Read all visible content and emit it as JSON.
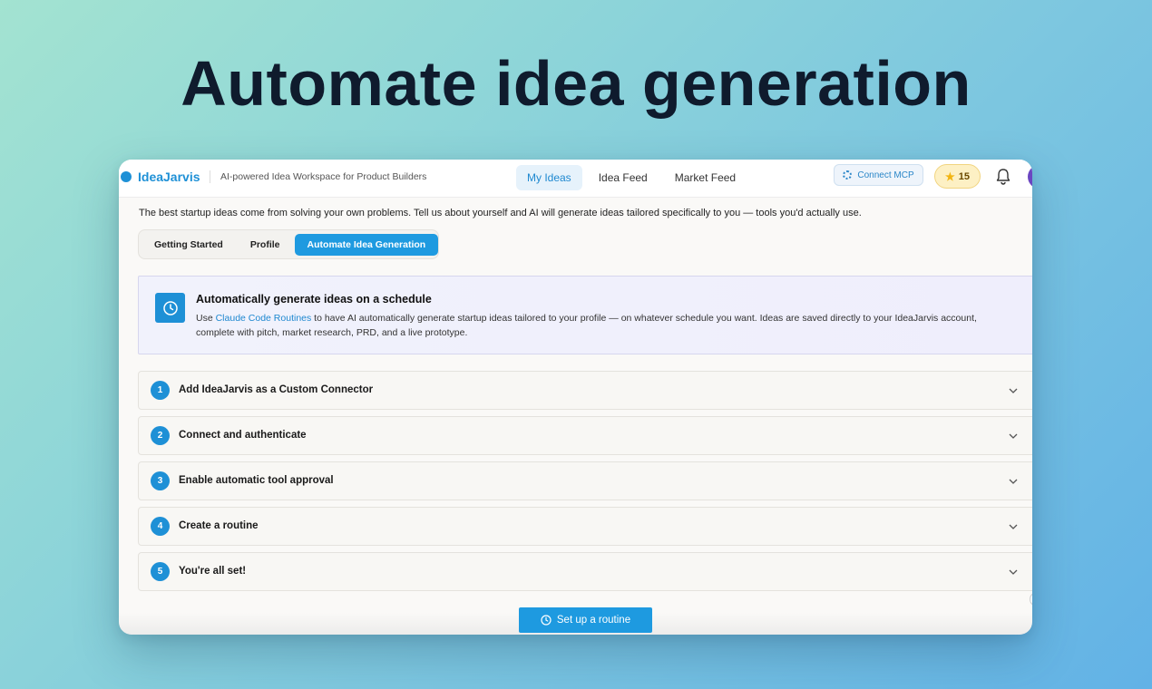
{
  "hero": {
    "title": "Automate idea generation"
  },
  "app": {
    "brand": "IdeaJarvis",
    "tagline": "AI-powered Idea Workspace for Product Builders",
    "nav": [
      {
        "label": "My Ideas",
        "active": true
      },
      {
        "label": "Idea Feed",
        "active": false
      },
      {
        "label": "Market Feed",
        "active": false
      }
    ],
    "connect_mcp": "Connect MCP",
    "credits": "15",
    "accent": "#1e90d6"
  },
  "main": {
    "intro": "The best startup ideas come from solving your own problems. Tell us about yourself and AI will generate ideas tailored specifically to you — tools you'd actually use.",
    "tabs": [
      {
        "label": "Getting Started",
        "active": false
      },
      {
        "label": "Profile",
        "active": false
      },
      {
        "label": "Automate Idea Generation",
        "active": true
      }
    ],
    "banner": {
      "title": "Automatically generate ideas on a schedule",
      "desc_prefix": "Use ",
      "desc_link": "Claude Code Routines",
      "desc_suffix": " to have AI automatically generate startup ideas tailored to your profile — on whatever schedule you want. Ideas are saved directly to your IdeaJarvis account, complete with pitch, market research, PRD, and a live prototype."
    },
    "steps": [
      {
        "num": "1",
        "label": "Add IdeaJarvis as a Custom Connector"
      },
      {
        "num": "2",
        "label": "Connect and authenticate"
      },
      {
        "num": "3",
        "label": "Enable automatic tool approval"
      },
      {
        "num": "4",
        "label": "Create a routine"
      },
      {
        "num": "5",
        "label": "You're all set!"
      }
    ],
    "cta": "Set up a routine"
  }
}
